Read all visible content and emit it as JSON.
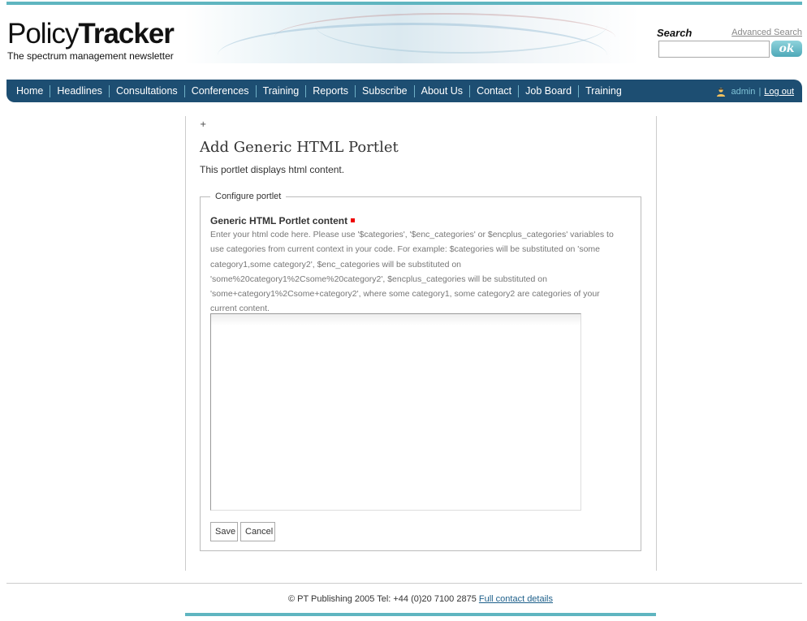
{
  "header": {
    "logo_light": "Policy",
    "logo_bold": "Tracker",
    "tagline": "The spectrum management newsletter"
  },
  "search": {
    "label": "Search",
    "advanced_link": "Advanced Search",
    "value": "",
    "button_label": "ok"
  },
  "nav": {
    "items": [
      "Home",
      "Headlines",
      "Consultations",
      "Conferences",
      "Training",
      "Reports",
      "Subscribe",
      "About Us",
      "Contact",
      "Job Board",
      "Training"
    ]
  },
  "user": {
    "name": "admin",
    "separator": "|",
    "logout": "Log out"
  },
  "portlet": {
    "plus": "+",
    "title": "Add Generic HTML Portlet",
    "description": "This portlet displays html content.",
    "legend": "Configure portlet",
    "field_label": "Generic HTML Portlet content",
    "help_text": "Enter your html code here. Please use '$categories', '$enc_categories' or $encplus_categories' variables to use categories from current context in your code. For example: $categories will be substituted on 'some category1,some category2', $enc_categories will be substituted on 'some%20category1%2Csome%20category2', $encplus_categories will be substituted on 'some+category1%2Csome+category2', where some category1, some category2 are categories of your current content.",
    "content_value": "",
    "save_label": "Save",
    "cancel_label": "Cancel"
  },
  "footer": {
    "text": "© PT Publishing 2005 Tel: +44 (0)20 7100 2875",
    "link": "Full contact details"
  },
  "colors": {
    "nav_bg": "#1d4e72",
    "accent": "#5fb5c0",
    "required": "#ee0000"
  }
}
